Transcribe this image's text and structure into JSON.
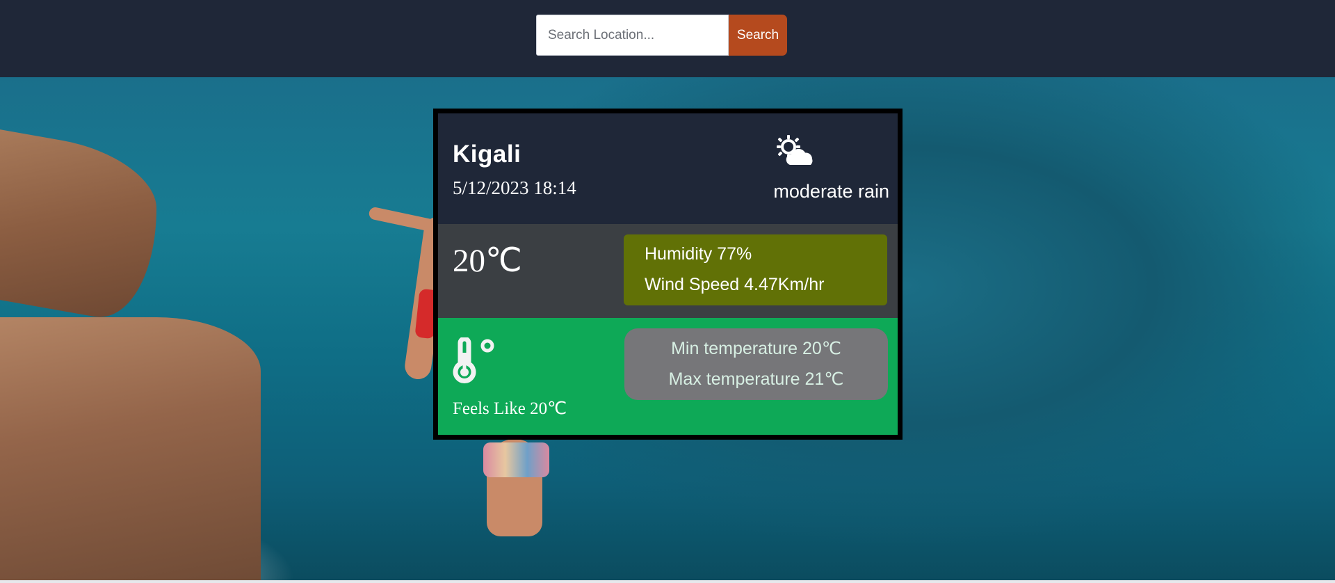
{
  "search": {
    "placeholder": "Search Location...",
    "button_label": "Search"
  },
  "weather": {
    "city": "Kigali",
    "datetime": "5/12/2023 18:14",
    "condition": "moderate rain",
    "condition_icon": "sun-behind-cloud-icon",
    "temperature": "20℃",
    "humidity": "Humidity 77%",
    "wind_speed": "Wind Speed 4.47Km/hr",
    "feels_icon": "thermometer-degree-icon",
    "feels_like": "Feels Like 20℃",
    "min_temp_label": "Min temperature 20",
    "max_temp_label": "Max temperature 21",
    "temp_unit": "℃"
  },
  "colors": {
    "topbar": "#1f2738",
    "search_button": "#b54a1e",
    "card_header": "#1f2738",
    "card_middle": "#3b3f43",
    "stats_box": "#617106",
    "card_bottom": "#0ea957",
    "minmax_box": "#767679"
  }
}
